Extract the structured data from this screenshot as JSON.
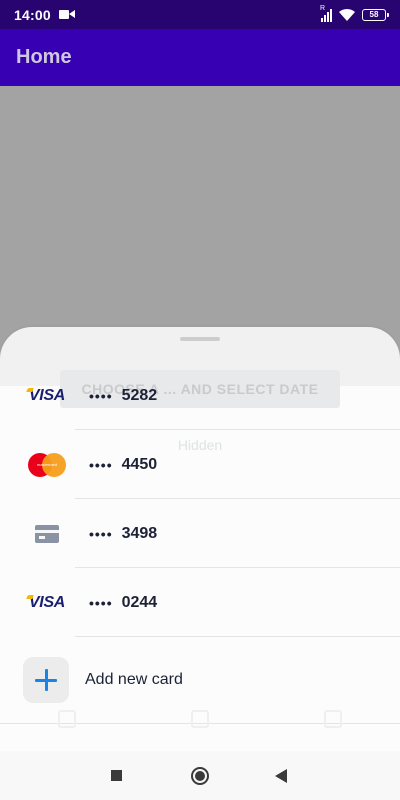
{
  "status_bar": {
    "time": "14:00",
    "battery": "58",
    "signal_label": "R",
    "icons": [
      "camera-icon",
      "signal-icon",
      "wifi-icon",
      "battery-icon"
    ]
  },
  "app_bar": {
    "title": "Home",
    "color": "#3700b3"
  },
  "background": {
    "button_text": "CHOOSE A ... AND SELECT DATE",
    "text": "Hidden"
  },
  "sheet": {
    "cards": [
      {
        "brand": "VISA",
        "brand_icon": "visa-logo",
        "mask": "••••",
        "last4": "5282"
      },
      {
        "brand": "mastercard",
        "brand_icon": "mastercard-logo",
        "mask": "••••",
        "last4": "4450"
      },
      {
        "brand": "",
        "brand_icon": "credit-card-icon",
        "mask": "••••",
        "last4": "3498"
      },
      {
        "brand": "VISA",
        "brand_icon": "visa-logo",
        "mask": "••••",
        "last4": "0244"
      }
    ],
    "add_card_label": "Add new card",
    "accent": "#1a84e6"
  },
  "nav_bar": {
    "icons": [
      "recents-square-icon",
      "home-circle-icon",
      "back-triangle-icon"
    ]
  }
}
